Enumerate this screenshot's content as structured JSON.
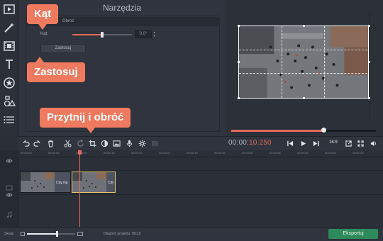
{
  "panel": {
    "title": "Narzędzia",
    "section_title": "Obróć",
    "angle_label": "Kąt:",
    "angle_value": "0.0°",
    "apply_button": "Zastosuj"
  },
  "callouts": {
    "angle": "Kąt",
    "apply": "Zastosuj",
    "crop_rotate": "Przytnij i obróć"
  },
  "player": {
    "time_white": "00:00:",
    "time_red": "10.250",
    "aspect_ratio": "16:9",
    "progress": 0.63
  },
  "ruler": {
    "ticks": [
      "00:00:00",
      "00:00:05",
      "00:00:10",
      "00:00:15",
      "00:00:20",
      "00:00:25",
      "00:00:30",
      "00:00:35",
      "00:00:40",
      "00:00:45",
      "00:00:50",
      "00:00:55",
      "00:01:00"
    ]
  },
  "clips": [
    {
      "label": "City.mp"
    },
    {
      "label": "City"
    }
  ],
  "status": {
    "scale_label": "Skala:",
    "project_length": "Długość projektu: 00:10",
    "export_button": "Eksportuj"
  },
  "colors": {
    "accent": "#e36a5a",
    "callout": "#f07a5f",
    "export": "#2e8a5a"
  }
}
